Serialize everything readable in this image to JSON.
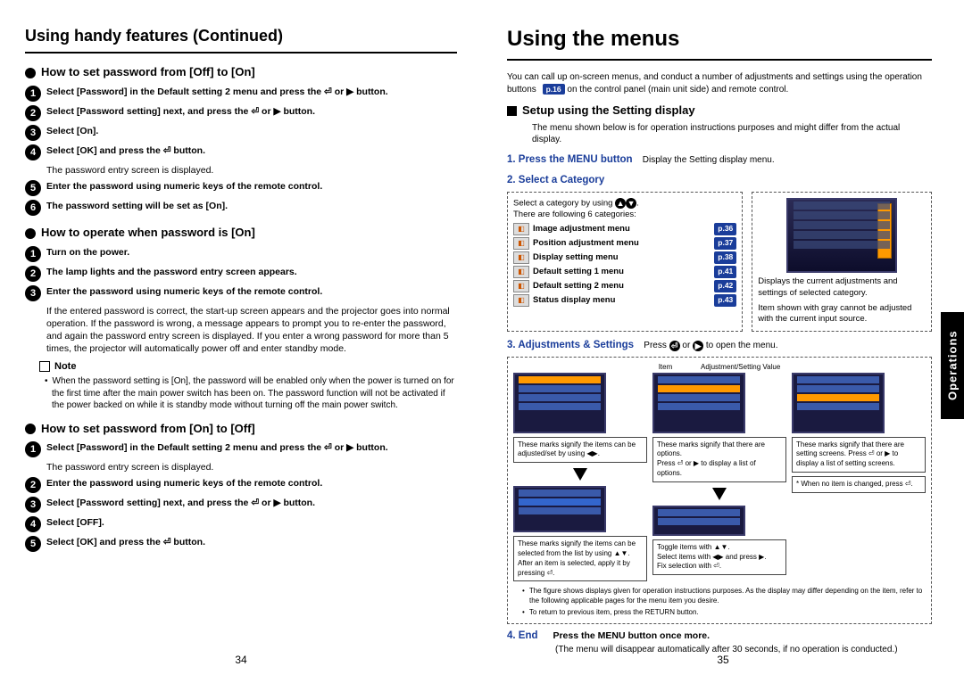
{
  "left": {
    "page_title": "Using handy features (Continued)",
    "page_number": "34",
    "sec_off_on": {
      "title": "How to set password from [Off] to [On]",
      "steps": [
        "Select [Password] in the Default setting 2 menu and press the ⏎ or ▶ button.",
        "Select [Password setting] next, and press the ⏎ or ▶ button.",
        "Select [On].",
        "Select [OK] and press the ⏎ button.",
        "Enter the password using numeric keys of the remote control.",
        "The password setting will be set as [On]."
      ],
      "step4_desc": "The password entry screen is displayed."
    },
    "sec_operate": {
      "title": "How to operate when password is [On]",
      "steps": [
        "Turn on the power.",
        "The lamp lights and the password entry screen appears.",
        "Enter the password using numeric keys of the remote control."
      ],
      "step3_desc": "If the entered password is correct, the start-up screen appears and the projector goes into normal operation. If the password is wrong, a message appears to prompt you to re-enter the password, and again the password entry screen is displayed. If you enter a wrong password for more than 5 times, the projector will automatically power off and enter standby mode."
    },
    "note": {
      "title": "Note",
      "items": [
        "When the password setting is [On], the password will be enabled only when the power is turned on for the first time after the main power switch has been on. The password function will not be activated if the power backed on while it is standby mode without turning off the main power switch."
      ]
    },
    "sec_on_off": {
      "title": "How to set password from [On] to [Off]",
      "steps": [
        "Select [Password] in the Default setting 2 menu and press the ⏎ or ▶ button.",
        "Enter the password using numeric keys of the remote control.",
        "Select [Password setting] next, and press the ⏎ or ▶ button.",
        "Select [OFF].",
        "Select [OK] and press the ⏎ button."
      ],
      "step1_desc": "The password entry screen is displayed."
    }
  },
  "right": {
    "page_title": "Using the menus",
    "page_number": "35",
    "intro_a": "You can call up on-screen menus, and conduct a number of adjustments and settings using the operation buttons ",
    "intro_ref": "p.16",
    "intro_b": " on the control panel (main unit side) and remote control.",
    "setup_title": "Setup using the Setting display",
    "setup_desc": "The menu shown below is for operation instructions purposes and might differ from the actual display.",
    "step1": {
      "label": "1. Press the MENU button",
      "desc": "Display the Setting display menu."
    },
    "step2": {
      "label": "2. Select a Category",
      "intro_a": "Select a category by using ",
      "intro_b": ".",
      "intro2": "There are following 6 categories:",
      "menus": [
        {
          "name": "Image adjustment menu",
          "ref": "p.36"
        },
        {
          "name": "Position adjustment menu",
          "ref": "p.37"
        },
        {
          "name": "Display setting menu",
          "ref": "p.38"
        },
        {
          "name": "Default setting 1 menu",
          "ref": "p.41"
        },
        {
          "name": "Default setting 2 menu",
          "ref": "p.42"
        },
        {
          "name": "Status display menu",
          "ref": "p.43"
        }
      ],
      "right_text_a": "Displays the current adjustments and settings of selected category.",
      "right_text_b": "Item shown with gray cannot be adjusted with the current input source."
    },
    "step3": {
      "label": "3. Adjustments & Settings",
      "desc_a": "Press ",
      "desc_b": " or ",
      "desc_c": " to open the menu.",
      "label_item": "Item",
      "label_val": "Adjustment/Setting Value",
      "call_left": "These marks signify the items can be adjusted/set by using ◀▶.",
      "call_mid_a": "These marks signify that there are options.",
      "call_mid_b": "Press ⏎ or ▶ to display a list of options.",
      "call_right_a": "These marks signify that there are setting screens. Press ⏎ or ▶ to display a list of setting screens.",
      "call_noitem": "* When no item is changed, press ⏎.",
      "call_sel": "These marks signify the items can be selected from the list by using ▲▼.",
      "call_sel_b": "After an item is selected, apply it by pressing ⏎.",
      "toggle_a": "Toggle items with ▲▼.",
      "toggle_b": "Select items with ◀▶ and press ▶.",
      "toggle_c": "Fix selection with ⏎."
    },
    "foot_notes": [
      "The figure shows displays given for operation instructions purposes.  As the display may differ depending on the item, refer to the following applicable pages for the menu item you desire.",
      "To return to previous item, press the RETURN button."
    ],
    "step4": {
      "label": "4. End",
      "desc": "Press the MENU button once more.",
      "sub": "(The menu will disappear automatically after 30 seconds, if no operation is conducted.)"
    },
    "side_tab": "Operations"
  }
}
